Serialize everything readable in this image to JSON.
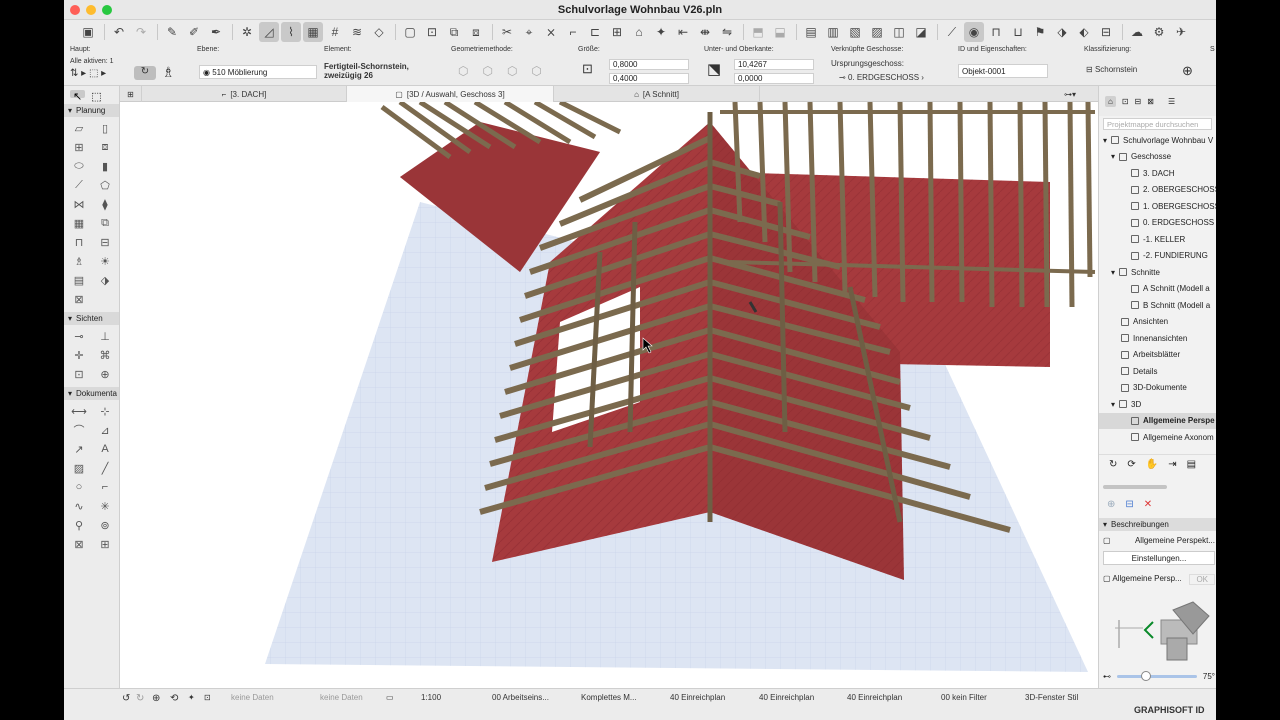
{
  "window": {
    "title": "Schulvorlage Wohnbau V26.pln"
  },
  "colors": {
    "roof": "#a63a3d",
    "timber": "#7b6a4e",
    "floor": "#dde5f3",
    "accent": "#2b6cd6"
  },
  "infobox": {
    "haupt_label": "Haupt:",
    "alle_aktiven": "Alle aktiven: 1",
    "ebene_label": "Ebene:",
    "ebene_value": "510 Möblierung",
    "element_label": "Element:",
    "element_value_1": "Fertigteil-Schornstein,",
    "element_value_2": "zweizügig 26",
    "geometrie_label": "Geometriemethode:",
    "groesse_label": "Größe:",
    "groesse_a": "0,8000",
    "groesse_b": "0,4000",
    "oberkante_label": "Unter- und Oberkante:",
    "oberkante_a": "10,4267",
    "oberkante_b": "0,0000",
    "geschosse_label": "Verknüpfte Geschosse:",
    "ursprung_label": "Ursprungsgeschoss:",
    "ursprung_value": "0. ERDGESCHOSS",
    "id_label": "ID und Eigenschaften:",
    "id_value": "Objekt-0001",
    "klass_label": "Klassifizierung:",
    "klass_value": "Schornstein",
    "s_label": "S"
  },
  "tabs": [
    {
      "label": "[3. DACH]"
    },
    {
      "label": "[3D / Auswahl, Geschoss 3]"
    },
    {
      "label": "[A Schnitt]"
    }
  ],
  "toolbox": {
    "planung": "Planung",
    "sichten": "Sichten",
    "dokumente": "Dokumenta"
  },
  "navigator": {
    "search_placeholder": "Projektmappe durchsuchen",
    "root": "Schulvorlage Wohnbau V",
    "items": [
      {
        "label": "Geschosse"
      },
      {
        "label": "3. DACH"
      },
      {
        "label": "2. OBERGESCHOSS"
      },
      {
        "label": "1. OBERGESCHOSS"
      },
      {
        "label": "0. ERDGESCHOSS"
      },
      {
        "label": "-1. KELLER"
      },
      {
        "label": "-2. FUNDIERUNG"
      },
      {
        "label": "Schnitte"
      },
      {
        "label": "A Schnitt (Modell a"
      },
      {
        "label": "B Schnitt (Modell a"
      },
      {
        "label": "Ansichten"
      },
      {
        "label": "Innenansichten"
      },
      {
        "label": "Arbeitsblätter"
      },
      {
        "label": "Details"
      },
      {
        "label": "3D-Dokumente"
      },
      {
        "label": "3D"
      },
      {
        "label": "Allgemeine Perspe"
      },
      {
        "label": "Allgemeine Axonom"
      }
    ],
    "beschreibungen": "Beschreibungen",
    "view_name": "Allgemeine Perspekt...",
    "einstellungen": "Einstellungen...",
    "view_name2": "Allgemeine Persp...",
    "ok": "OK",
    "angle": "75°"
  },
  "statusbar": {
    "keine1": "keine Daten",
    "keine2": "keine Daten",
    "scale": "1:100",
    "arbeitseins": "00 Arbeitseins...",
    "komplettes": "Komplettes M...",
    "einreich1": "40 Einreichplan",
    "einreich2": "40 Einreichplan",
    "einreich3": "40 Einreichplan",
    "filter": "00 kein Filter",
    "fenster": "3D-Fenster Stil"
  },
  "brand": "GRAPHISOFT ID"
}
